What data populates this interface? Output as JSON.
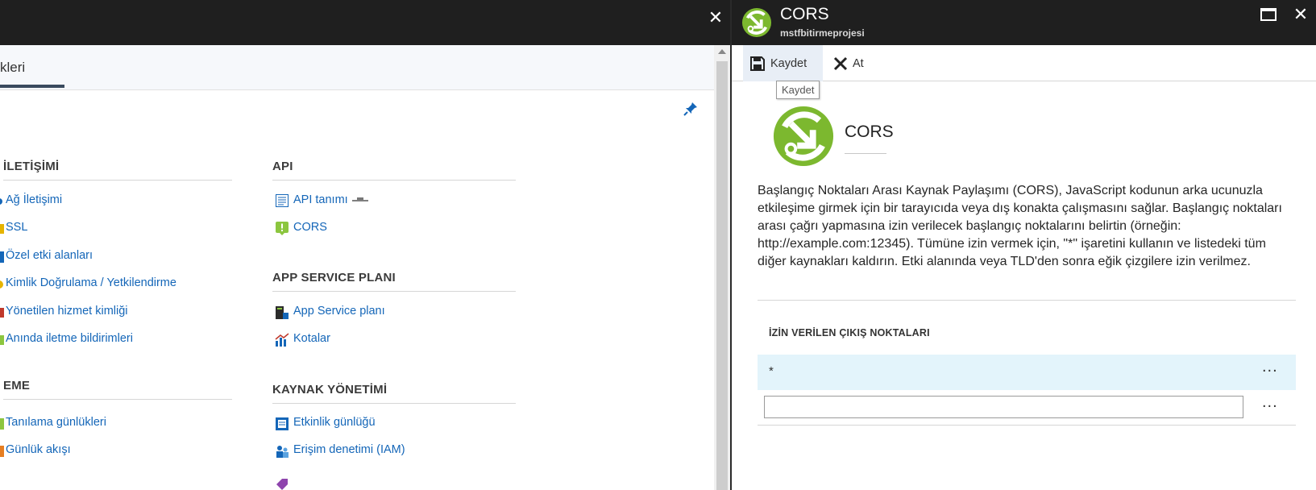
{
  "left_blade": {
    "tab_label": "kleri",
    "sections_col1": [
      {
        "title": "İLETİŞİMİ",
        "items": [
          "Ağ İletişimi",
          "SSL",
          "Özel etki alanları",
          "Kimlik Doğrulama / Yetkilendirme",
          "Yönetilen hizmet kimliği",
          "Anında iletme bildirimleri"
        ]
      },
      {
        "title": "EME",
        "items": [
          "Tanılama günlükleri",
          "Günlük akışı"
        ]
      }
    ],
    "sections_col2": [
      {
        "title": "API",
        "items": [
          "API tanımı",
          "CORS"
        ]
      },
      {
        "title": "APP SERVICE PLANI",
        "items": [
          "App Service planı",
          "Kotalar"
        ]
      },
      {
        "title": "KAYNAK YÖNETİMİ",
        "items": [
          "Etkinlik günlüğü",
          "Erişim denetimi (IAM)"
        ]
      }
    ]
  },
  "right_blade": {
    "title": "CORS",
    "subtitle": "mstfbitirmeprojesi",
    "toolbar": {
      "save_label": "Kaydet",
      "discard_label": "At",
      "tooltip": "Kaydet"
    },
    "hero_title": "CORS",
    "description": "Başlangıç Noktaları Arası Kaynak Paylaşımı (CORS), JavaScript kodunun arka ucunuzla etkileşime girmek için bir tarayıcıda veya dış konakta çalışmasını sağlar. Başlangıç noktaları arası çağrı yapmasına izin verilecek başlangıç noktalarını belirtin (örneğin: http://example.com:12345). Tümüne izin vermek için, \"*\" işaretini kullanın ve listedeki tüm diğer kaynakları kaldırın. Etki alanında veya TLD'den sonra eğik çizgilere izin verilmez.",
    "origins_header": "İZİN VERİLEN ÇIKIŞ NOKTALARI",
    "origins": [
      "*"
    ],
    "new_origin_value": "",
    "more_label": "..."
  },
  "colors": {
    "titlebar": "#1f1f1f",
    "link": "#1466b8",
    "selected_row": "#e3f4fb",
    "cors_green": "#7cb82f"
  }
}
